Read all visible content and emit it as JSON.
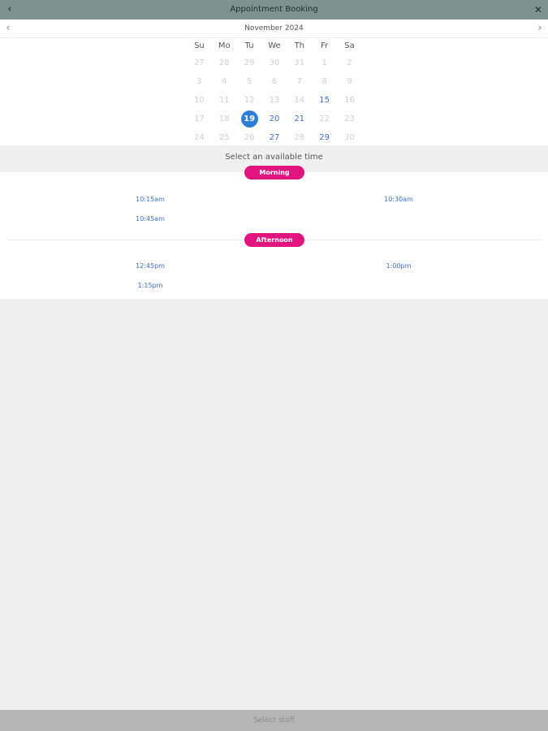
{
  "header": {
    "title": "Appointment Booking",
    "back_glyph": "‹",
    "close_glyph": "✕",
    "back_icon": "chevron-left-icon",
    "close_icon": "close-icon"
  },
  "calendar": {
    "month": "November 2024",
    "prev_glyph": "‹",
    "next_glyph": "›",
    "weekdays": [
      "Su",
      "Mo",
      "Tu",
      "We",
      "Th",
      "Fr",
      "Sa"
    ],
    "weeks": [
      [
        {
          "d": "27",
          "s": "off"
        },
        {
          "d": "28",
          "s": "off"
        },
        {
          "d": "29",
          "s": "off"
        },
        {
          "d": "30",
          "s": "off"
        },
        {
          "d": "31",
          "s": "off"
        },
        {
          "d": "1",
          "s": "off"
        },
        {
          "d": "2",
          "s": "off"
        }
      ],
      [
        {
          "d": "3",
          "s": "off"
        },
        {
          "d": "4",
          "s": "off"
        },
        {
          "d": "5",
          "s": "off"
        },
        {
          "d": "6",
          "s": "off"
        },
        {
          "d": "7",
          "s": "off"
        },
        {
          "d": "8",
          "s": "off"
        },
        {
          "d": "9",
          "s": "off"
        }
      ],
      [
        {
          "d": "10",
          "s": "off"
        },
        {
          "d": "11",
          "s": "off"
        },
        {
          "d": "12",
          "s": "off"
        },
        {
          "d": "13",
          "s": "off"
        },
        {
          "d": "14",
          "s": "off"
        },
        {
          "d": "15",
          "s": "avail"
        },
        {
          "d": "16",
          "s": "off"
        }
      ],
      [
        {
          "d": "17",
          "s": "off"
        },
        {
          "d": "18",
          "s": "off"
        },
        {
          "d": "19",
          "s": "sel"
        },
        {
          "d": "20",
          "s": "avail"
        },
        {
          "d": "21",
          "s": "avail"
        },
        {
          "d": "22",
          "s": "off"
        },
        {
          "d": "23",
          "s": "off"
        }
      ],
      [
        {
          "d": "24",
          "s": "off"
        },
        {
          "d": "25",
          "s": "off"
        },
        {
          "d": "26",
          "s": "off"
        },
        {
          "d": "27",
          "s": "avail"
        },
        {
          "d": "28",
          "s": "off"
        },
        {
          "d": "29",
          "s": "avail"
        },
        {
          "d": "30",
          "s": "off"
        }
      ]
    ]
  },
  "time_select": {
    "prompt": "Select an available time",
    "morning_label": "Morning",
    "afternoon_label": "Afternoon",
    "morning_slots": [
      "10:15am",
      "10:30am",
      "10:45am"
    ],
    "afternoon_slots": [
      "12:45pm",
      "1:00pm",
      "1:15pm"
    ]
  },
  "footer": {
    "label": "Select staff"
  },
  "colors": {
    "header_bg": "#7c948f",
    "accent_pink": "#e2147e",
    "selected_day": "#2f7fd8",
    "link_blue": "#3b6fd1"
  }
}
